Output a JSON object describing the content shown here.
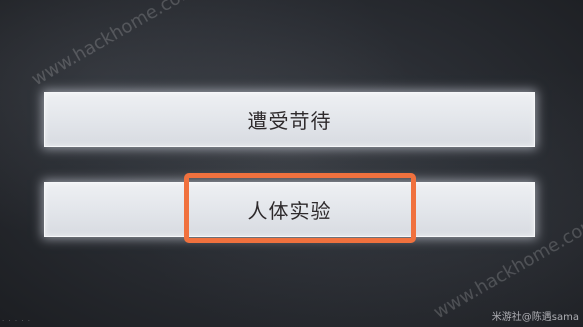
{
  "choices": [
    {
      "label": "遭受苛待"
    },
    {
      "label": "人体实验"
    }
  ],
  "highlighted_choice": "人体实验",
  "watermarks": [
    "www.hackhome.com",
    "www.hackhome.com"
  ],
  "credit": "米游社@陈遇sama",
  "corner_mark": "· · · · ·",
  "colors": {
    "highlight_border": "#f0713e",
    "choice_bg": "#e6e8ec",
    "choice_text": "#2e2a2c",
    "background": "#2a2d33"
  }
}
